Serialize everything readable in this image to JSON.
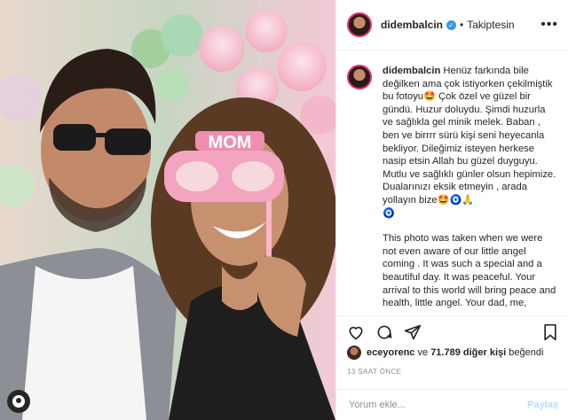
{
  "header": {
    "username": "didembalcin",
    "verified_mark": "✓",
    "separator": "•",
    "follow_status": "Takiptesin",
    "more_icon": "•••"
  },
  "caption": {
    "username": "didembalcin",
    "text_tr": "Henüz farkında bile değilken ama çok istiyorken çekilmiştik bu fotoyu🤩 Çok özel ve güzel bir gündü. Huzur doluydu. Şimdi huzurla ve sağlıkla gel minik melek. Baban , ben ve birrrr sürü kişi seni heyecanla bekliyor. Dileğimiz isteyen herkese nasip etsin Allah bu güzel duyguyu. Mutlu ve sağlıklı günler olsun hepimize. Dualarınızı eksik etmeyin , arada yollayın bize🤩🧿🙏\n🧿",
    "text_en": "This photo was taken when we were not even aware of our little angel coming . It was such a special and a beautiful day. It was peaceful. Your arrival to this world will bring peace and health, little angel. Your dad, me,"
  },
  "photo": {
    "glasses_text": "MOM"
  },
  "likes": {
    "user": "eceyorenc",
    "connector": "ve",
    "count": "71.789 diğer kişi",
    "suffix": "beğendi"
  },
  "time": "13 SAAT ÖNCE",
  "comment_box": {
    "placeholder": "Yorum ekle...",
    "post_label": "Paylaş"
  },
  "icons": [
    "heart-icon",
    "comment-icon",
    "share-icon",
    "bookmark-icon",
    "profile-icon"
  ],
  "colors": {
    "link_blue": "#3897f0",
    "post_disabled": "#b2dffc",
    "muted": "#8e8e8e"
  }
}
